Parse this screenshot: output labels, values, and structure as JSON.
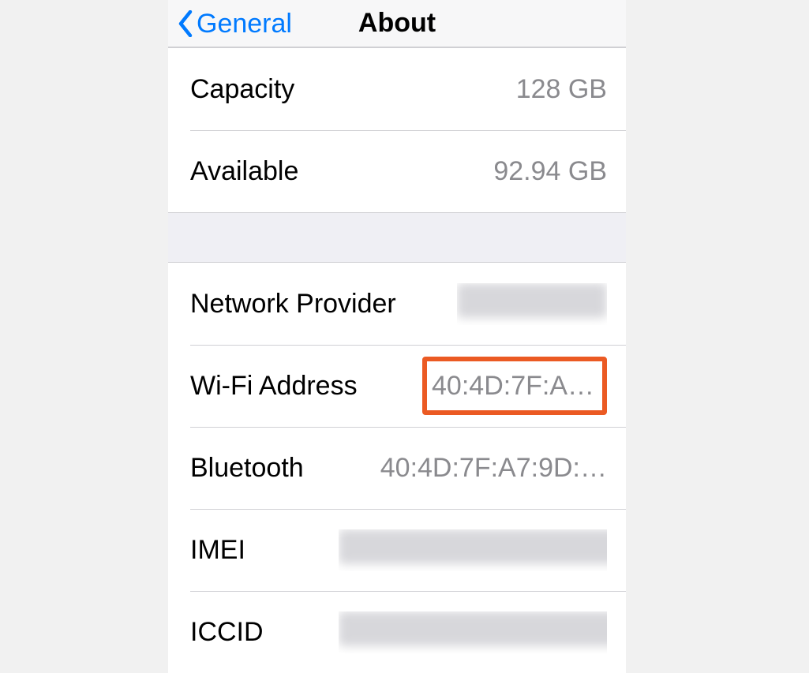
{
  "nav": {
    "back_label": "General",
    "title": "About"
  },
  "group1": {
    "capacity_label": "Capacity",
    "capacity_value": "128 GB",
    "available_label": "Available",
    "available_value": "92.94 GB"
  },
  "group2": {
    "network_label": "Network Provider",
    "network_value": "",
    "wifi_label": "Wi-Fi Address",
    "wifi_value": "40:4D:7F:A…",
    "bt_label": "Bluetooth",
    "bt_value": "40:4D:7F:A7:9D:…",
    "imei_label": "IMEI",
    "imei_value": "",
    "iccid_label": "ICCID",
    "iccid_value": ""
  }
}
